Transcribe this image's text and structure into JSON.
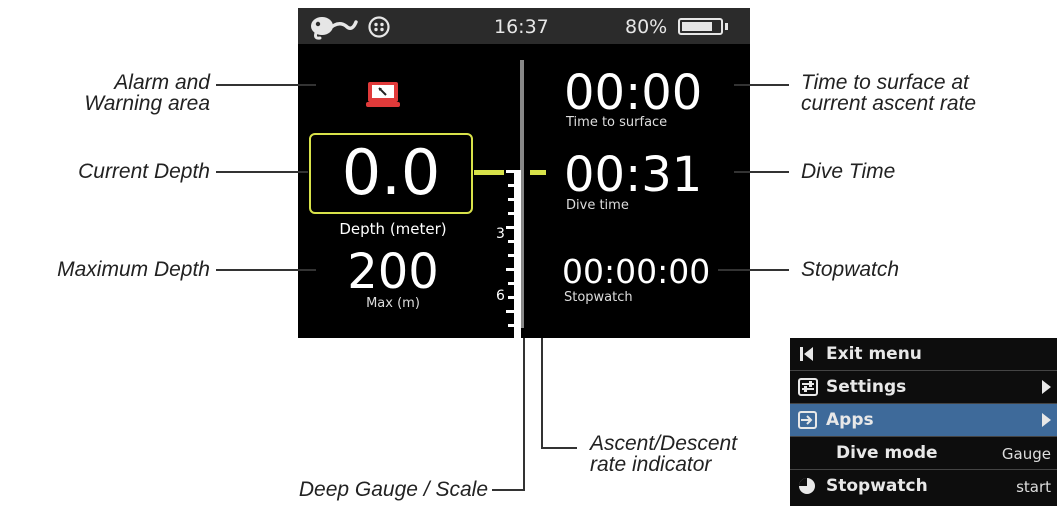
{
  "status_bar": {
    "time": "16:37",
    "battery_percent_text": "80%",
    "battery_level": 0.8,
    "logo_icon": "octopus-logo-icon",
    "face_icon": "face-icon"
  },
  "screen": {
    "alarm_icon": "alarm-warning-icon",
    "current_depth": {
      "value": "0.0",
      "label": "Depth (meter)"
    },
    "max_depth": {
      "value": "200",
      "label": "Max (m)"
    },
    "time_to_surface": {
      "value": "00:00",
      "label": "Time to surface"
    },
    "dive_time": {
      "value": "00:31",
      "label": "Dive time"
    },
    "stopwatch": {
      "value": "00:00:00",
      "label": "Stopwatch"
    },
    "gauge_labels": [
      "3",
      "6"
    ],
    "accent_color": "#d8e24a"
  },
  "callouts": {
    "alarm_line1": "Alarm and",
    "alarm_line2": "Warning area",
    "current_depth": "Current Depth",
    "maximum_depth": "Maximum Depth",
    "tts_line1": "Time to surface at",
    "tts_line2": "current ascent rate",
    "dive_time": "Dive Time",
    "stopwatch": "Stopwatch",
    "ascent_line1": "Ascent/Descent",
    "ascent_line2": "rate indicator",
    "deep_gauge": "Deep Gauge / Scale"
  },
  "menu": {
    "items": [
      {
        "label": "Exit menu",
        "icon": "exit-back-icon",
        "value": ""
      },
      {
        "label": "Settings",
        "icon": "settings-icon",
        "value": ""
      },
      {
        "label": "Apps",
        "icon": "apps-enter-icon",
        "value": ""
      },
      {
        "label": "Dive mode",
        "icon": "",
        "value": "Gauge"
      },
      {
        "label": "Stopwatch",
        "icon": "clock-icon",
        "value": "start"
      }
    ],
    "selected_color": "#3e6a9a"
  }
}
